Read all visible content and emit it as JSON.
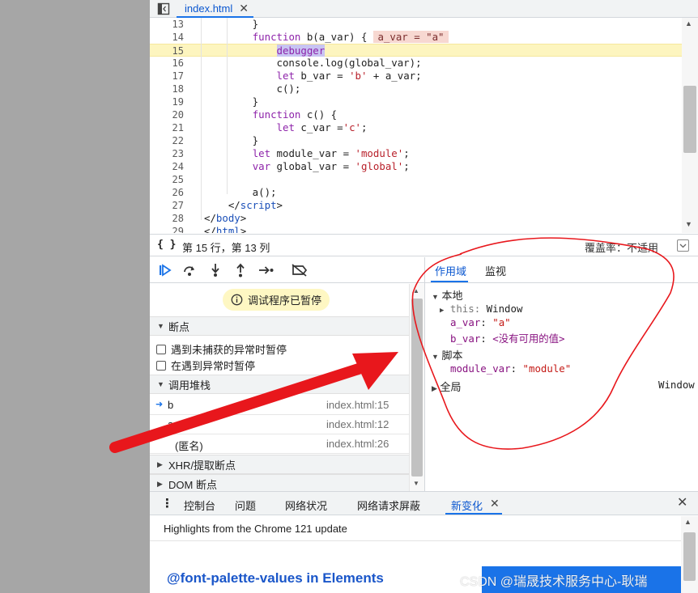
{
  "editor": {
    "file_tab": "index.html",
    "lines": [
      {
        "n": "13",
        "html": "        }",
        "hl": false
      },
      {
        "n": "14",
        "html": "        <span class=\"kw\">function</span> b(a_var) {<span class=\"inline-val\">a_var = \"a\"</span>",
        "hl": false
      },
      {
        "n": "15",
        "html": "            <span class=\"kw dbg\">debugger</span>",
        "hl": true
      },
      {
        "n": "16",
        "html": "            console.log(global_var);",
        "hl": false
      },
      {
        "n": "17",
        "html": "            <span class=\"kw\">let</span> b_var = <span class=\"str\">'b'</span> + a_var;",
        "hl": false
      },
      {
        "n": "18",
        "html": "            c();",
        "hl": false
      },
      {
        "n": "19",
        "html": "        }",
        "hl": false
      },
      {
        "n": "20",
        "html": "        <span class=\"kw\">function</span> c() {",
        "hl": false
      },
      {
        "n": "21",
        "html": "            <span class=\"kw\">let</span> c_var =<span class=\"str\">'c'</span>;",
        "hl": false
      },
      {
        "n": "22",
        "html": "        }",
        "hl": false
      },
      {
        "n": "23",
        "html": "        <span class=\"kw\">let</span> module_var = <span class=\"str\">'module'</span>;",
        "hl": false
      },
      {
        "n": "24",
        "html": "        <span class=\"kw\">var</span> global_var = <span class=\"str\">'global'</span>;",
        "hl": false
      },
      {
        "n": "25",
        "html": "",
        "hl": false
      },
      {
        "n": "26",
        "html": "        a();",
        "hl": false
      },
      {
        "n": "27",
        "html": "    &lt;/<span class=\"kw2\">script</span>&gt;",
        "hl": false
      },
      {
        "n": "28",
        "html": "&lt;/<span class=\"kw2\">body</span>&gt;",
        "hl": false
      },
      {
        "n": "29",
        "html": "&lt;/<span class=\"kw2\">html</span>&gt;",
        "hl": false
      }
    ]
  },
  "status": {
    "braces": "{ }",
    "cursor": "第 15 行，第 13 列",
    "coverage": "覆盖率：不适用"
  },
  "paused_banner": "调试程序已暂停",
  "sections": {
    "breakpoints": "断点",
    "pause_uncaught": "遇到未捕获的异常时暂停",
    "pause_caught": "在遇到异常时暂停",
    "call_stack": "调用堆栈",
    "xhr": "XHR/提取断点",
    "dom": "DOM 断点"
  },
  "call_stack": [
    {
      "fn": "b",
      "loc": "index.html:15",
      "current": true
    },
    {
      "fn": "a",
      "loc": "index.html:12",
      "current": false
    },
    {
      "fn": "(匿名)",
      "loc": "index.html:26",
      "current": false
    }
  ],
  "right_tabs": {
    "scope": "作用域",
    "watch": "监视"
  },
  "scope": {
    "local": "本地",
    "this_name": "this",
    "this_value": "Window",
    "a_var_name": "a_var",
    "a_var_value": "\"a\"",
    "b_var_name": "b_var",
    "b_var_value": "<没有可用的值>",
    "script": "脚本",
    "module_var_name": "module_var",
    "module_var_value": "\"module\"",
    "global": "全局",
    "global_value": "Window"
  },
  "drawer": {
    "tabs": [
      "控制台",
      "问题",
      "网络状况",
      "网络请求屏蔽",
      "新变化"
    ],
    "active_tab": "新变化",
    "highlights": "Highlights from the Chrome 121 update",
    "feature_title": "@font-palette-values in Elements"
  },
  "watermark": "CSDN @瑞晟技术服务中心-耿瑞",
  "colors": {
    "accent": "#1a73e8",
    "exec_line": "#fdf5bf",
    "annotation": "#e8171c"
  }
}
